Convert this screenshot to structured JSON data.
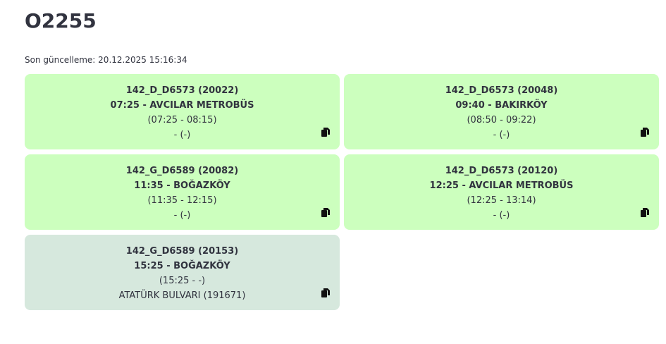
{
  "page": {
    "title": "O2255",
    "last_updated_label": "Son güncelleme: 20.12.2025 15:16:34"
  },
  "trips": [
    {
      "route": "142_D_D6573 (20022)",
      "departure": "07:25 - AVCILAR METROBÜS",
      "time_window": "(07:25 - 08:15)",
      "stop": "- (-)",
      "status": "active",
      "icon": "copy-icon"
    },
    {
      "route": "142_D_D6573 (20048)",
      "departure": "09:40 - BAKIRKÖY",
      "time_window": "(08:50 - 09:22)",
      "stop": "- (-)",
      "status": "active",
      "icon": "copy-icon"
    },
    {
      "route": "142_G_D6589 (20082)",
      "departure": "11:35 - BOĞAZKÖY",
      "time_window": "(11:35 - 12:15)",
      "stop": "- (-)",
      "status": "active",
      "icon": "copy-icon"
    },
    {
      "route": "142_D_D6573 (20120)",
      "departure": "12:25 - AVCILAR METROBÜS",
      "time_window": "(12:25 - 13:14)",
      "stop": "- (-)",
      "status": "active",
      "icon": "copy-icon"
    },
    {
      "route": "142_G_D6589 (20153)",
      "departure": "15:25 - BOĞAZKÖY",
      "time_window": "(15:25 - -)",
      "stop": "ATATÜRK BULVARI (191671)",
      "status": "inactive",
      "icon": "copy-icon"
    }
  ],
  "colors": {
    "card_active": "#ccffbe",
    "card_inactive": "#d6e8dd",
    "text": "#31333f"
  }
}
